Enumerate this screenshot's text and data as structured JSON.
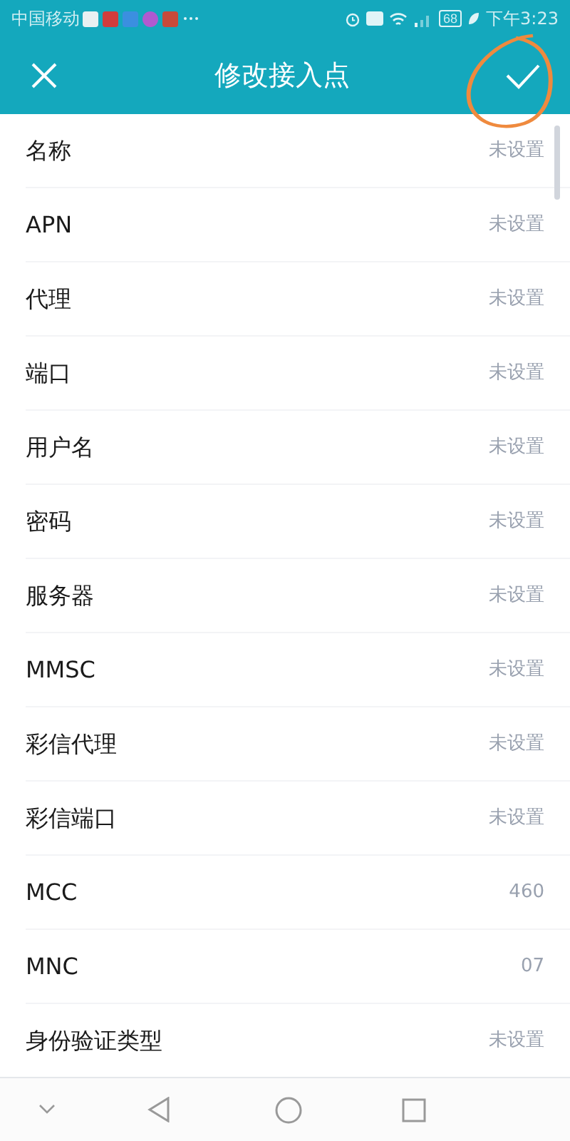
{
  "status_bar": {
    "carrier": "中国移动",
    "battery": "68",
    "time": "下午3:23"
  },
  "header": {
    "title": "修改接入点"
  },
  "fields": [
    {
      "label": "名称",
      "value": "未设置"
    },
    {
      "label": "APN",
      "value": "未设置"
    },
    {
      "label": "代理",
      "value": "未设置"
    },
    {
      "label": "端口",
      "value": "未设置"
    },
    {
      "label": "用户名",
      "value": "未设置"
    },
    {
      "label": "密码",
      "value": "未设置"
    },
    {
      "label": "服务器",
      "value": "未设置"
    },
    {
      "label": "MMSC",
      "value": "未设置"
    },
    {
      "label": "彩信代理",
      "value": "未设置"
    },
    {
      "label": "彩信端口",
      "value": "未设置"
    },
    {
      "label": "MCC",
      "value": "460"
    },
    {
      "label": "MNC",
      "value": "07"
    },
    {
      "label": "身份验证类型",
      "value": "未设置"
    }
  ]
}
